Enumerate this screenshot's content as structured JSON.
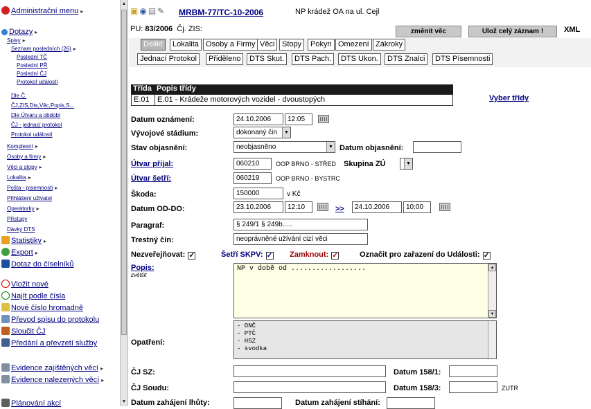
{
  "sidebar": {
    "admin_menu": "Administrační menu",
    "dotazy": "Dotazy",
    "spisy": "Spisy",
    "seznam": "Seznam posledních (26)",
    "posledni_tc": "Poslední TČ",
    "posledni_pr": "Poslední PŘ",
    "posledni_cj": "Poslední ČJ",
    "protokol1": "Protokol událostí",
    "dle_c": "Dle Č.",
    "cj_zis": "ČJ,ZIS,Dts,Věc,Popis,S...",
    "dle_utvaru": "Dle Útvaru a období",
    "cj_jednaci": "ČJ - jednací protokol",
    "protokol2": "Protokol událostí",
    "komplexni": "Komplexní",
    "osoby": "Osoby a firmy",
    "veci": "Věci a stopy",
    "lokalita": "Lokalita",
    "posta": "Pošta - písemnosti",
    "prihlaseni": "Přihlášení uživatel",
    "operatorky": "Operátorky",
    "pristupy": "Přístupy",
    "davky": "Dávky DTS",
    "statistiky": "Statistiky",
    "export": "Export",
    "dotaz_ciselnik": "Dotaz do číselníků",
    "vlozit": "Vložit nové",
    "najit": "Najít podle čísla",
    "nove_cislo": "Nové číslo hromadně",
    "prevod": "Převod spisu do protokolu",
    "sloucit": "Sloučit ČJ",
    "predani": "Předání a převzetí služby",
    "evidence_zaj": "Evidence zajištěných věcí",
    "evidence_nal": "Evidence nalezených věcí",
    "last": "Plánování akcí"
  },
  "header": {
    "case_id": "MRBM-77/TC-10-2006",
    "case_desc": "NP krádež OA na ul. Cejl",
    "pu_label": "PU:",
    "pu_value": "83/2006",
    "cj_zis": "Čj. ZIS:",
    "zmenit_vec": "změnit věc",
    "uloz": "Ulož celý záznam !",
    "xml": "XML"
  },
  "tabs_row1": [
    "Delikt",
    "Lokalita",
    "Osoby a Firmy",
    "Věci",
    "Stopy",
    "Pokyn",
    "Omezení",
    "Zákroky"
  ],
  "tabs_row2": [
    "Jednací Protokol",
    "Přiděleno",
    "DTS Skut.",
    "DTS Pach.",
    "DTS Ukon.",
    "DTS Znalci",
    "DTS Písemnosti"
  ],
  "trida": {
    "hdr_trida": "Třída",
    "hdr_popis": "Popis třídy",
    "code": "E.01",
    "desc": "E.01 - Krádeže motorových vozidel - dvoustopých",
    "vyber": "Vyber třídy"
  },
  "form": {
    "datum_oznameni_lbl": "Datum oznámení:",
    "datum_oznameni": "24.10.2006",
    "cas_oznameni": "12:05",
    "vyvojove_lbl": "Vývojové stádium:",
    "vyvojove": "dokonaný čin",
    "stav_lbl": "Stav objasnění:",
    "stav": "neobjasněno",
    "datum_objasneni_lbl": "Datum objasnění:",
    "datum_objasneni": "",
    "utvar_prijal_lbl": "Útvar přijal:",
    "utvar_prijal": "060210",
    "utvar_prijal_txt": "OOP BRNO - STŘED",
    "skupina_lbl": "Skupina ZÚ",
    "utvar_setri_lbl": "Útvar šetří:",
    "utvar_setri": "060219",
    "utvar_setri_txt": "OOP BRNO - BYSTRC",
    "skoda_lbl": "Škoda:",
    "skoda": "150000",
    "skoda_unit": "v Kč",
    "od_do_lbl": "Datum OD-DO:",
    "od_datum": "23.10.2006",
    "od_cas": "12:10",
    "arrow": ">>",
    "do_datum": "24.10.2006",
    "do_cas": "10:00",
    "paragraf_lbl": "Paragraf:",
    "paragraf": "§ 249/1 § 249b.....",
    "tc_lbl": "Trestný čin:",
    "tc": "neoprávněné užívání cizí věci",
    "nezverejnovat_lbl": "Nezveřejňovat:",
    "setri_skpv_lbl": "Šetří SKPV:",
    "zamknout_lbl": "Zamknout:",
    "oznacit_lbl": "Označit pro zařazení do Události:",
    "check": "✓",
    "popis_lbl": "Popis:",
    "zvetsit": "zvětšit",
    "popis": "NP v době od ..................",
    "opatreni_lbl": "Opatření:",
    "opatreni": [
      "- ONČ",
      "- PTČ",
      "- HSZ",
      "- svodka"
    ],
    "cj_sz_lbl": "ČJ SZ:",
    "cj_soudu_lbl": "ČJ Soudu:",
    "d158_1_lbl": "Datum 158/1:",
    "d158_3_lbl": "Datum 158/3:",
    "zutr": "ZUTR",
    "lhuta_lbl": "Datum zahájení lhůty:",
    "stihani_lbl": "Datum zahájení stíhání:"
  },
  "colors": {
    "link": "#00007f",
    "header_dark": "#1a1a1a",
    "tab_active": "#b7b7b7",
    "textarea_bg": "#ffffe6"
  }
}
